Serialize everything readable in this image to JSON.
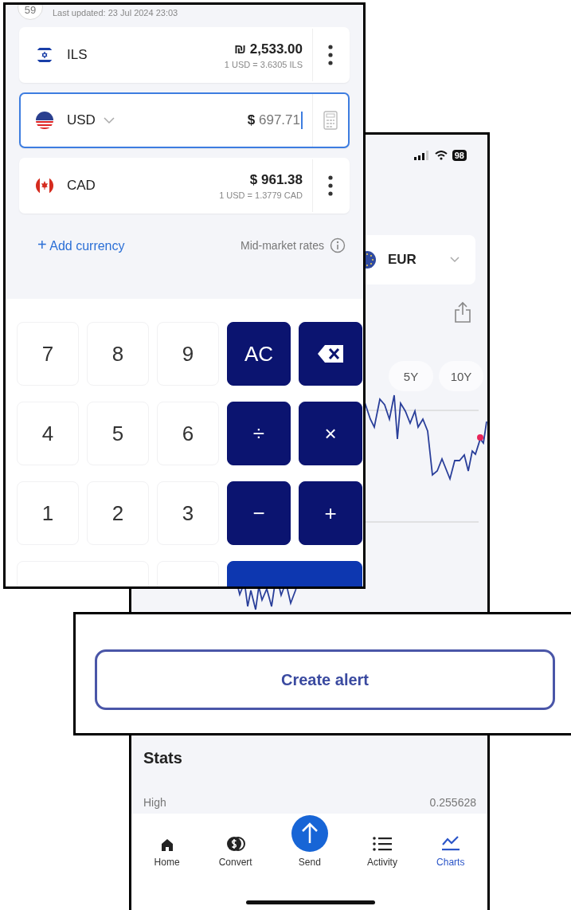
{
  "charts_screen": {
    "status_bar": {
      "battery": "98"
    },
    "currency": {
      "code": "EUR"
    },
    "ranges": [
      {
        "label": "5Y",
        "selected": false
      },
      {
        "label": "10Y",
        "selected": false
      }
    ],
    "stats": {
      "title": "Stats",
      "rows": [
        {
          "label": "High",
          "value": "0.255628"
        }
      ]
    },
    "tab_bar": [
      {
        "label": "Home",
        "selected": false
      },
      {
        "label": "Convert",
        "selected": false
      },
      {
        "label": "Send",
        "selected": false
      },
      {
        "label": "Activity",
        "selected": false
      },
      {
        "label": "Charts",
        "selected": true
      }
    ]
  },
  "converter_screen": {
    "badge": "59",
    "last_updated": "Last updated: 23 Jul 2024 23:03",
    "currencies": [
      {
        "code": "ILS",
        "amount": "₪ 2,533.00",
        "rate": "1 USD = 3.6305 ILS",
        "selected": false
      },
      {
        "code": "USD",
        "symbol": "$",
        "amount": "697.71",
        "selected": true
      },
      {
        "code": "CAD",
        "amount": "$ 961.38",
        "rate": "1 USD = 1.3779 CAD",
        "selected": false
      }
    ],
    "add_currency": {
      "icon": "+",
      "label": "Add currency"
    },
    "rates_note": "Mid-market rates",
    "keypad": [
      {
        "kind": "digit",
        "label": "7"
      },
      {
        "kind": "digit",
        "label": "8"
      },
      {
        "kind": "digit",
        "label": "9"
      },
      {
        "kind": "operator",
        "label": "AC"
      },
      {
        "kind": "backspace"
      },
      {
        "kind": "digit",
        "label": "4"
      },
      {
        "kind": "digit",
        "label": "5"
      },
      {
        "kind": "digit",
        "label": "6"
      },
      {
        "kind": "operator",
        "label": "÷"
      },
      {
        "kind": "operator",
        "label": "×"
      },
      {
        "kind": "digit",
        "label": "1"
      },
      {
        "kind": "digit",
        "label": "2"
      },
      {
        "kind": "digit",
        "label": "3"
      },
      {
        "kind": "operator",
        "label": "−"
      },
      {
        "kind": "operator",
        "label": "+"
      },
      {
        "kind": "empty-wide"
      },
      {
        "kind": "empty"
      },
      {
        "kind": "primary-wide"
      }
    ]
  },
  "alert_panel": {
    "button": "Create alert"
  }
}
